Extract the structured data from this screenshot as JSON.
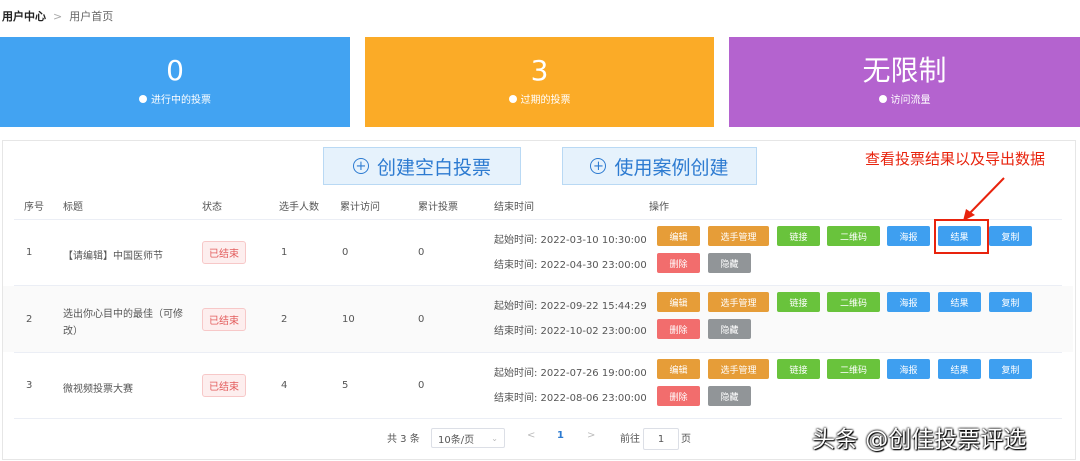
{
  "breadcrumb": {
    "root": "用户中心",
    "current": "用户首页"
  },
  "stats": [
    {
      "value": "0",
      "label": "进行中的投票",
      "color": "#42a3f2"
    },
    {
      "value": "3",
      "label": "过期的投票",
      "color": "#fbab27"
    },
    {
      "value": "无限制",
      "label": "访问流量",
      "color": "#b463cf"
    }
  ],
  "actions": {
    "create_blank": "创建空白投票",
    "create_from_case": "使用案例创建"
  },
  "annotation": "查看投票结果以及导出数据",
  "table": {
    "headers": [
      "序号",
      "标题",
      "状态",
      "选手人数",
      "累计访问",
      "累计投票",
      "结束时间",
      "操作"
    ],
    "rows": [
      {
        "index": "1",
        "title": "【请编辑】中国医师节",
        "title2": "",
        "status": "已结束",
        "players": "1",
        "visits": "0",
        "votes": "0",
        "start": "起始时间: 2022-03-10 10:30:00",
        "end": "结束时间: 2022-04-30 23:00:00"
      },
      {
        "index": "2",
        "title": "选出你心目中的最佳（可修",
        "title2": "改）",
        "status": "已结束",
        "players": "2",
        "visits": "10",
        "votes": "0",
        "start": "起始时间: 2022-09-22 15:44:29",
        "end": "结束时间: 2022-10-02 23:00:00"
      },
      {
        "index": "3",
        "title": "微视频投票大赛",
        "title2": "",
        "status": "已结束",
        "players": "4",
        "visits": "5",
        "votes": "0",
        "start": "起始时间: 2022-07-26 19:00:00",
        "end": "结束时间: 2022-08-06 23:00:00"
      }
    ],
    "ops": {
      "edit": "编辑",
      "players": "选手管理",
      "link": "链接",
      "qrcode": "二维码",
      "poster": "海报",
      "result": "结果",
      "copy": "复制",
      "delete": "删除",
      "hide": "隐藏"
    }
  },
  "pagination": {
    "total": "共 3 条",
    "page_size": "10条/页",
    "current_page": "1",
    "goto_label": "前往",
    "goto_value": "1",
    "page_unit": "页"
  },
  "watermark": "头条 @创佳投票评选"
}
